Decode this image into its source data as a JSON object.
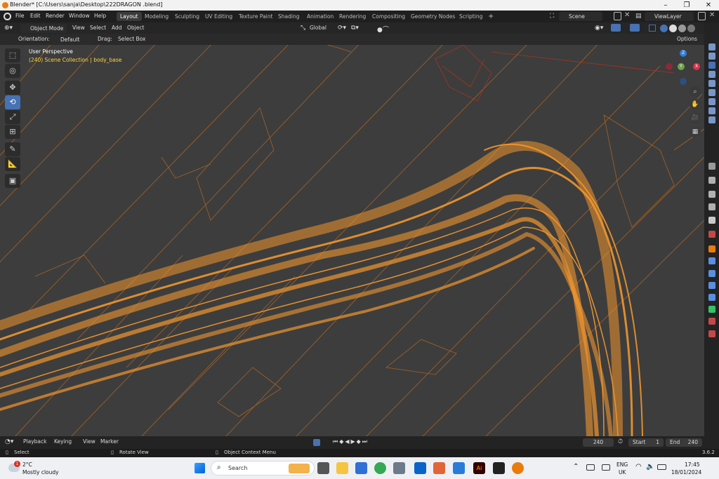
{
  "window": {
    "title": "Blender* [C:\\Users\\sanja\\Desktop\\222DRAGON .blend]"
  },
  "menus": [
    "File",
    "Edit",
    "Render",
    "Window",
    "Help"
  ],
  "workspaces": [
    "Layout",
    "Modeling",
    "Sculpting",
    "UV Editing",
    "Texture Paint",
    "Shading",
    "Animation",
    "Rendering",
    "Compositing",
    "Geometry Nodes",
    "Scripting"
  ],
  "active_workspace": "Layout",
  "scene": "Scene",
  "view_layer": "ViewLayer",
  "header": {
    "mode": "Object Mode",
    "view": "View",
    "select": "Select",
    "add": "Add",
    "object": "Object",
    "transform": "Global"
  },
  "header2": {
    "orientation_label": "Orientation:",
    "orientation_value": "Default",
    "drag_label": "Drag:",
    "drag_value": "Select Box",
    "options": "Options"
  },
  "viewport": {
    "title": "User Perspective",
    "collection": "(240) Scene Collection | body_base"
  },
  "gizmo": {
    "z": "Z",
    "y": "Y",
    "x": "X"
  },
  "timeline": {
    "playback": "Playback",
    "keying": "Keying",
    "view": "View",
    "marker": "Marker",
    "current_frame": "240",
    "start_label": "Start",
    "start": "1",
    "end_label": "End",
    "end": "240"
  },
  "status": {
    "select": "Select",
    "rotate": "Rotate View",
    "context": "Object Context Menu",
    "version": "3.6.2"
  },
  "taskbar": {
    "temp": "2°C",
    "weather": "Mostly cloudy",
    "badge": "1",
    "search": "Search",
    "lang1": "ENG",
    "lang2": "UK",
    "time": "17:45",
    "date": "18/01/2024"
  },
  "colors": {
    "accent": "#4772b3",
    "wire": "#e8862a",
    "collection_text": "#ffd23f",
    "viewport_bg": "#3d3d3d"
  }
}
